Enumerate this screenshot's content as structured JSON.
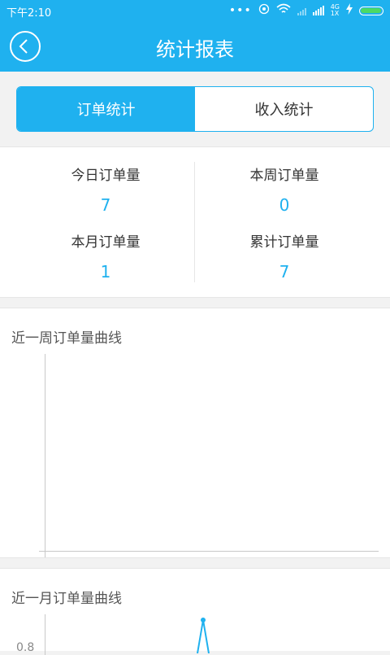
{
  "status_bar": {
    "time": "下午2:10",
    "network_label": "4G",
    "network_sub": "1X",
    "battery_level": 1.0
  },
  "nav": {
    "title": "统计报表"
  },
  "tabs": [
    {
      "label": "订单统计",
      "active": true
    },
    {
      "label": "收入统计",
      "active": false
    }
  ],
  "stats": {
    "today": {
      "label": "今日订单量",
      "value": "7"
    },
    "week": {
      "label": "本周订单量",
      "value": "0"
    },
    "month": {
      "label": "本月订单量",
      "value": "1"
    },
    "total": {
      "label": "累计订单量",
      "value": "7"
    }
  },
  "weekly_chart": {
    "title": "近一周订单量曲线"
  },
  "monthly_chart": {
    "title": "近一月订单量曲线",
    "visible_tick": "0.8"
  },
  "colors": {
    "accent": "#1fb1ef",
    "background": "#f2f2f2",
    "text": "#333333"
  }
}
